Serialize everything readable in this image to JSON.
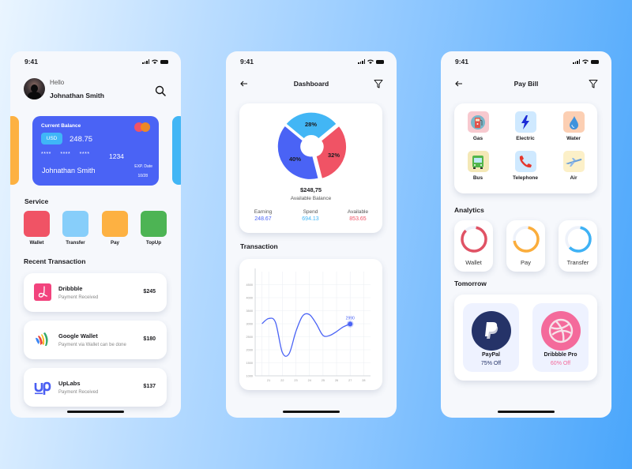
{
  "status_bar": {
    "time": "9:41"
  },
  "screens": {
    "home": {
      "greeting": "Hello",
      "user_name": "Johnathan Smith",
      "balance_card": {
        "title": "Current Balance",
        "currency": "USD",
        "amount": "248.75",
        "masked_groups": "**** **** ****",
        "last4": "1234",
        "holder": "Johnathan Smith",
        "exp_label": "EXP. Date",
        "exp_value": "10/28"
      },
      "service_title": "Service",
      "services": [
        {
          "label": "Wallet",
          "color": "#f05365"
        },
        {
          "label": "Transfer",
          "color": "#87cefa"
        },
        {
          "label": "Pay",
          "color": "#fdb142"
        },
        {
          "label": "TopUp",
          "color": "#4db454"
        }
      ],
      "recent_title": "Recent Transaction",
      "transactions": [
        {
          "name": "Dribbble",
          "desc": "Payment Received",
          "amount": "$245",
          "logo": "dribbble-logo"
        },
        {
          "name": "Google Wallet",
          "desc": "Payment via Wallet can be done",
          "amount": "$180",
          "logo": "google-wallet-logo"
        },
        {
          "name": "UpLabs",
          "desc": "Payment Received",
          "amount": "$137",
          "logo": "uplabs-logo"
        }
      ]
    },
    "dashboard": {
      "title": "Dashboard",
      "balance": "$248,75",
      "balance_label": "Available Balance",
      "stats": [
        {
          "label": "Earning",
          "value": "248.67",
          "color": "#4a63f5"
        },
        {
          "label": "Spend",
          "value": "694.13",
          "color": "#3fb6f7"
        },
        {
          "label": "Available",
          "value": "853.65",
          "color": "#f05365"
        }
      ],
      "transaction_title": "Transaction"
    },
    "pay_bill": {
      "title": "Pay Bill",
      "bills": [
        {
          "label": "Gas",
          "bg": "#f7c9cf"
        },
        {
          "label": "Electric",
          "bg": "#cfe9ff"
        },
        {
          "label": "Water",
          "bg": "#fccfb3"
        },
        {
          "label": "Bus",
          "bg": "#f4e8b6"
        },
        {
          "label": "Telephone",
          "bg": "#cfe9ff"
        },
        {
          "label": "Air",
          "bg": "#fcf0c8"
        }
      ],
      "analytics_title": "Analytics",
      "analytics": [
        {
          "label": "Wallet",
          "progress": 0.85,
          "color": "#e05264"
        },
        {
          "label": "Pay",
          "progress": 0.7,
          "color": "#fbad3b"
        },
        {
          "label": "Transfer",
          "progress": 0.6,
          "color": "#3fb2f5"
        }
      ],
      "tomorrow_title": "Tomorrow",
      "offers": [
        {
          "name": "PayPal",
          "discount": "75% Off",
          "color": "#253368"
        },
        {
          "name": "Dribbble Pro",
          "discount": "60% Off",
          "color": "#f46a9b"
        }
      ]
    }
  },
  "chart_data": [
    {
      "type": "pie",
      "title": "",
      "donut": true,
      "slices": [
        {
          "label": "28%",
          "value": 28,
          "color": "#42b6f5"
        },
        {
          "label": "32%",
          "value": 32,
          "color": "#f05365"
        },
        {
          "label": "40%",
          "value": 40,
          "color": "#4a63f5"
        }
      ]
    },
    {
      "type": "line",
      "title": "Transaction",
      "x": [
        20.5,
        21,
        21.5,
        22,
        22.5,
        23,
        23.5,
        24,
        24.5,
        25,
        25.5,
        26,
        26.5,
        27
      ],
      "y": [
        3000,
        3200,
        3050,
        1900,
        1850,
        2700,
        3300,
        3350,
        3000,
        2550,
        2550,
        2700,
        2880,
        2990
      ],
      "xticks": [
        "21",
        "22",
        "23",
        "24",
        "25",
        "26",
        "27",
        "28"
      ],
      "yticks": [
        "1000",
        "1500",
        "2000",
        "2500",
        "3000",
        "3500",
        "4000",
        "4500"
      ],
      "xlim": [
        20,
        28.5
      ],
      "ylim": [
        1000,
        5000
      ],
      "grid": true,
      "annotation": {
        "x": 27,
        "y": 2990,
        "label": "2990"
      },
      "line_color": "#4a63f5"
    }
  ]
}
